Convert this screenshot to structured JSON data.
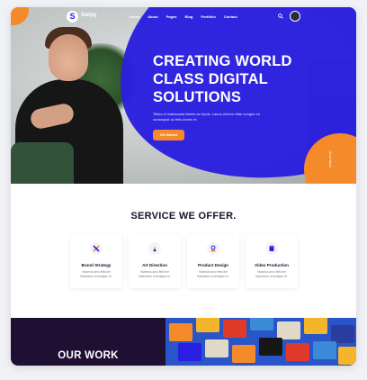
{
  "brand": {
    "name": "Swipy",
    "mark": "S"
  },
  "nav": {
    "items": [
      "Home",
      "About",
      "Pages",
      "Blog",
      "Portfolio",
      "Contact"
    ]
  },
  "hero": {
    "title": "CREATING WORLD CLASS DIGITAL SOLUTIONS",
    "description": "Tellus et malesuada fames ac turpis. Lacus viverra vitae congue eu consequat ac felis donec et.",
    "cta_label": "Get Started",
    "scroll_label": "Scroll down"
  },
  "services": {
    "title": "SERVICE WE OFFER.",
    "items": [
      {
        "name": "Brand Strategy",
        "desc": "Vivamus arcu felis the bibendum ut tristique et.",
        "icon": "brand-strategy-icon"
      },
      {
        "name": "Art Direction",
        "desc": "Vivamus arcu felis the bibendum ut tristique et.",
        "icon": "art-direction-icon"
      },
      {
        "name": "Product Design",
        "desc": "Vivamus arcu felis the bibendum ut tristique et.",
        "icon": "product-design-icon"
      },
      {
        "name": "Video Production",
        "desc": "Vivamus arcu felis the bibendum ut tristique et.",
        "icon": "video-production-icon"
      }
    ]
  },
  "work": {
    "title": "OUR WORK"
  },
  "colors": {
    "primary": "#2a1ee0",
    "accent": "#f58a2a",
    "dark": "#1f0f33"
  }
}
